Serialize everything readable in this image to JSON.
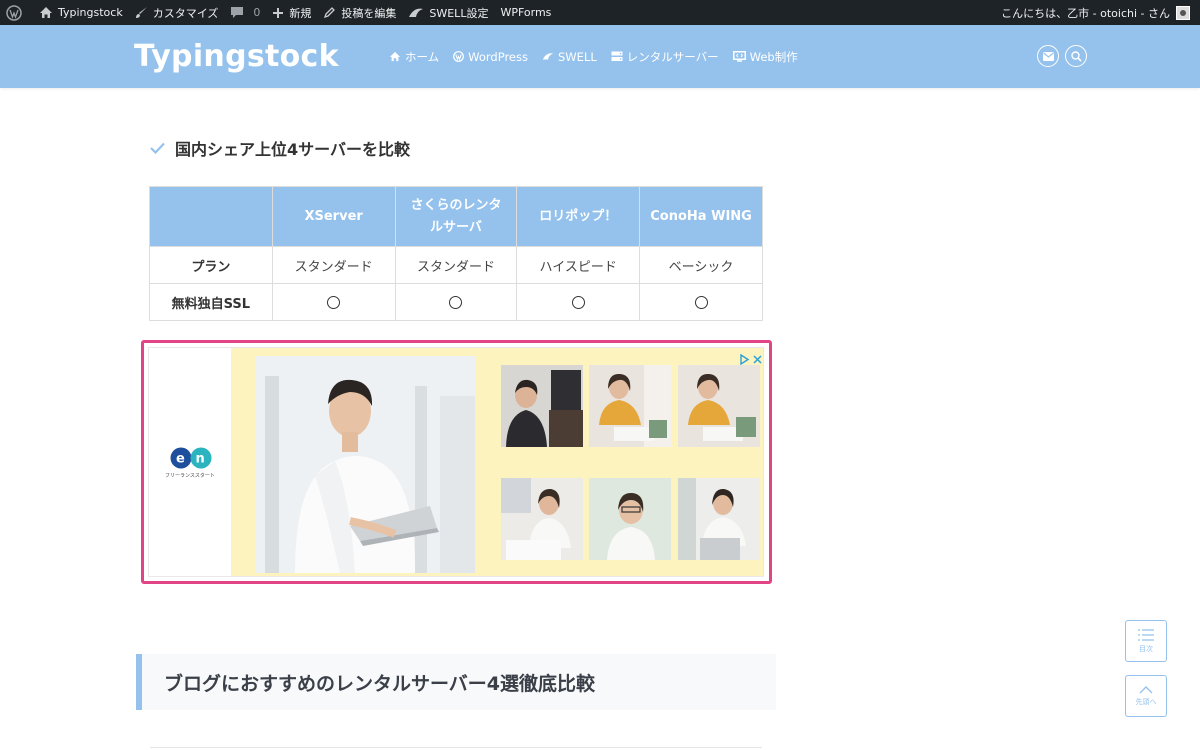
{
  "adminbar": {
    "site_name": "Typingstock",
    "customize": "カスタマイズ",
    "comments_count": "0",
    "new": "新規",
    "edit_post": "投稿を編集",
    "swell_settings": "SWELL設定",
    "wpforms": "WPForms",
    "greeting": "こんにちは、乙市 - otoichi - さん"
  },
  "header": {
    "logo": "Typingstock",
    "nav": [
      {
        "label": "ホーム",
        "icon": "home-icon"
      },
      {
        "label": "WordPress",
        "icon": "wordpress-icon"
      },
      {
        "label": "SWELL",
        "icon": "swell-icon"
      },
      {
        "label": "レンタルサーバー",
        "icon": "server-icon"
      },
      {
        "label": "Web制作",
        "icon": "monitor-icon"
      }
    ]
  },
  "section": {
    "h4": "国内シェア上位4サーバーを比較",
    "table": {
      "headers": [
        "",
        "XServer",
        "さくらのレンタルサーバ",
        "ロリポップ！",
        "ConoHa WING"
      ],
      "rows": [
        {
          "label": "プラン",
          "cells": [
            "スタンダード",
            "スタンダード",
            "ハイスピード",
            "ベーシック"
          ]
        },
        {
          "label": "無料独自SSL",
          "cells": [
            "",
            "",
            "",
            ""
          ]
        }
      ]
    },
    "ad": {
      "brand": "en",
      "brand_sub": "フリーランススタート"
    },
    "h2": "ブログにおすすめのレンタルサーバー4選徹底比較"
  },
  "fixed": {
    "toc_label": "目次",
    "top_label": "先頭へ"
  },
  "colors": {
    "accent": "#94c2ec",
    "ad_border": "#e24585",
    "adminbar_bg": "#1d2327"
  }
}
